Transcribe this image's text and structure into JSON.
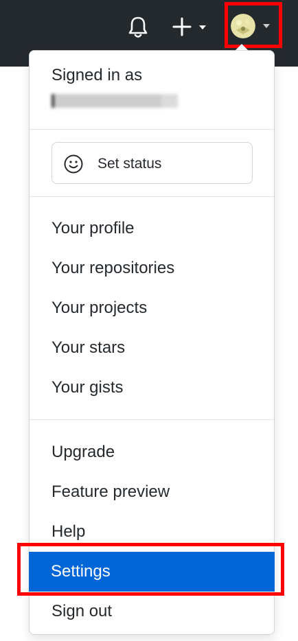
{
  "header": {
    "icons": [
      "bell-icon",
      "plus-icon",
      "avatar"
    ]
  },
  "menu": {
    "signed_in_label": "Signed in as",
    "set_status_label": "Set status",
    "section_profile": [
      {
        "label": "Your profile"
      },
      {
        "label": "Your repositories"
      },
      {
        "label": "Your projects"
      },
      {
        "label": "Your stars"
      },
      {
        "label": "Your gists"
      }
    ],
    "section_misc": [
      {
        "label": "Upgrade"
      },
      {
        "label": "Feature preview"
      },
      {
        "label": "Help"
      },
      {
        "label": "Settings"
      },
      {
        "label": "Sign out"
      }
    ],
    "active_item": "Settings"
  },
  "colors": {
    "topbar": "#24292e",
    "highlight": "#ff0000",
    "active_bg": "#0366d6"
  }
}
